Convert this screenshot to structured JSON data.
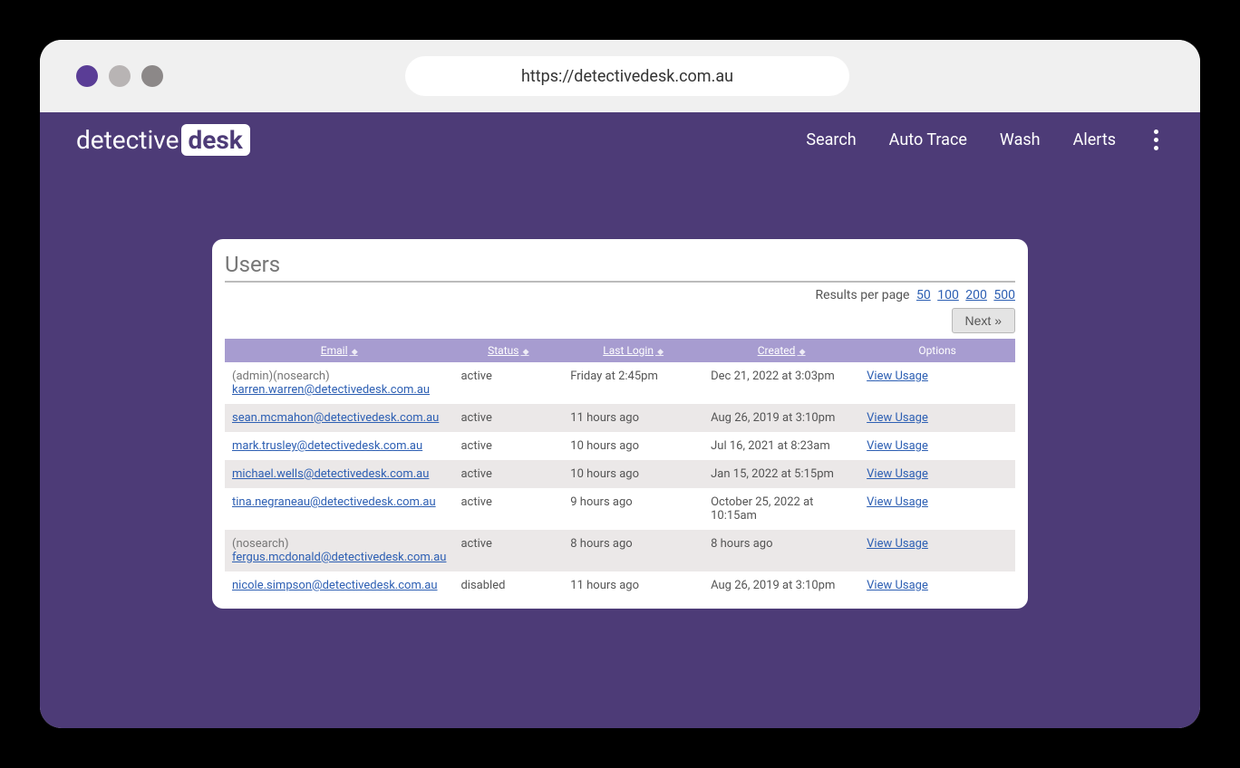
{
  "browser": {
    "url": "https://detectivedesk.com.au"
  },
  "brand": {
    "prefix": "detective",
    "badge": "desk"
  },
  "nav": {
    "items": [
      "Search",
      "Auto Trace",
      "Wash",
      "Alerts"
    ]
  },
  "panel": {
    "title": "Users",
    "results_label": "Results per page",
    "page_sizes": [
      "50",
      "100",
      "200",
      "500"
    ],
    "next_label": "Next »"
  },
  "columns": {
    "email": "Email",
    "status": "Status",
    "last_login": "Last Login",
    "created": "Created",
    "options": "Options"
  },
  "view_usage_label": "View Usage",
  "rows": [
    {
      "prefix": "(admin)(nosearch)",
      "email": "karren.warren@detectivedesk.com.au",
      "status": "active",
      "last_login": "Friday at 2:45pm",
      "created": "Dec 21, 2022 at 3:03pm"
    },
    {
      "prefix": "",
      "email": "sean.mcmahon@detectivedesk.com.au",
      "status": "active",
      "last_login": "11 hours ago",
      "created": "Aug 26, 2019 at 3:10pm"
    },
    {
      "prefix": "",
      "email": "mark.trusley@detectivedesk.com.au",
      "status": "active",
      "last_login": "10 hours ago",
      "created": "Jul 16, 2021 at 8:23am"
    },
    {
      "prefix": "",
      "email": "michael.wells@detectivedesk.com.au",
      "status": "active",
      "last_login": "10 hours ago",
      "created": "Jan 15, 2022 at 5:15pm"
    },
    {
      "prefix": "",
      "email": "tina.negraneau@detectivedesk.com.au",
      "status": "active",
      "last_login": "9 hours ago",
      "created": "October 25, 2022 at 10:15am"
    },
    {
      "prefix": "(nosearch)",
      "email": "fergus.mcdonald@detectivedesk.com.au",
      "status": "active",
      "last_login": "8 hours ago",
      "created": "8 hours ago"
    },
    {
      "prefix": "",
      "email": "nicole.simpson@detectivedesk.com.au",
      "status": "disabled",
      "last_login": "11 hours ago",
      "created": "Aug 26, 2019 at 3:10pm"
    }
  ]
}
